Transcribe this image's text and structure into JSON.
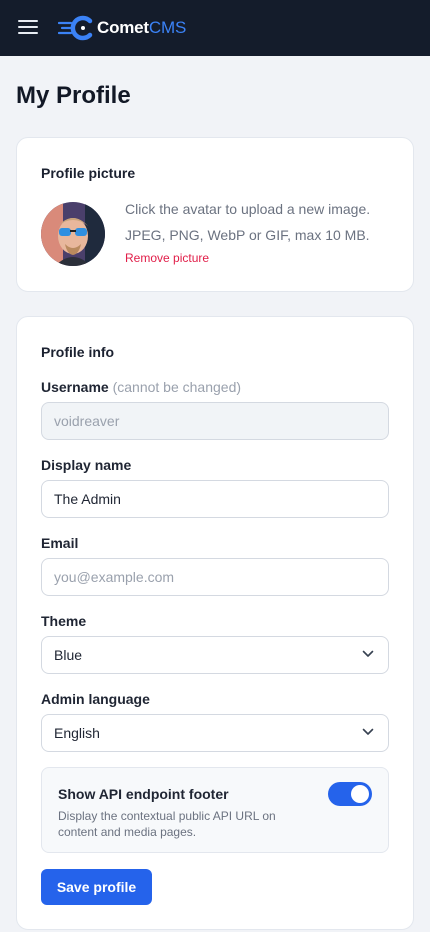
{
  "header": {
    "logo_main": "Comet",
    "logo_accent": "CMS",
    "accent_color": "#3b82f6",
    "background_color": "#141c2b"
  },
  "page": {
    "title": "My Profile"
  },
  "profile_picture": {
    "title": "Profile picture",
    "help_line1": "Click the avatar to upload a new image.",
    "help_line2": "JPEG, PNG, WebP or GIF, max 10 MB.",
    "remove_label": "Remove picture"
  },
  "profile_info": {
    "title": "Profile info",
    "username": {
      "label": "Username",
      "hint": "(cannot be changed)",
      "value": "voidreaver"
    },
    "display_name": {
      "label": "Display name",
      "value": "The Admin"
    },
    "email": {
      "label": "Email",
      "placeholder": "you@example.com"
    },
    "theme": {
      "label": "Theme",
      "value": "Blue"
    },
    "admin_language": {
      "label": "Admin language",
      "value": "English"
    },
    "api_footer": {
      "title": "Show API endpoint footer",
      "description": "Display the contextual public API URL on content and media pages.",
      "enabled": true
    },
    "save_label": "Save profile",
    "primary_color": "#2563eb"
  }
}
